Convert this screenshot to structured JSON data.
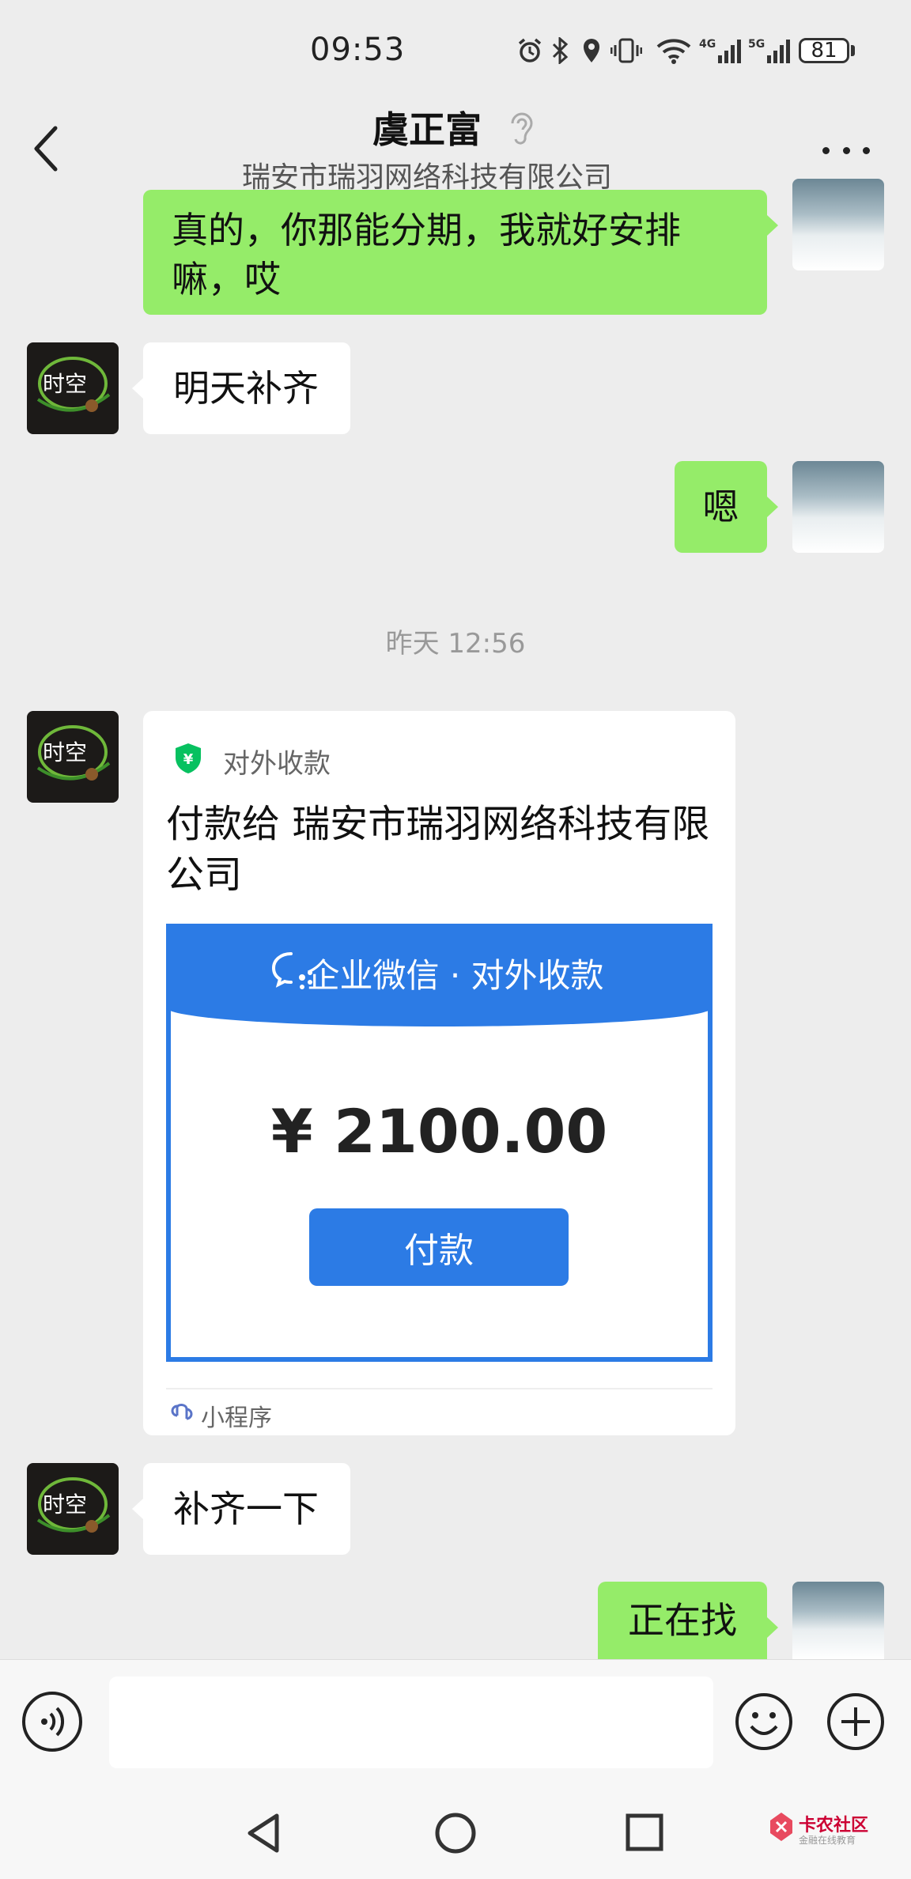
{
  "status_bar": {
    "time": "09:53",
    "battery": "81",
    "network_1": "4G",
    "network_2": "5G",
    "icons": [
      "alarm-icon",
      "bluetooth-icon",
      "location-icon",
      "vibrate-icon",
      "wifi-icon",
      "signal-icon"
    ]
  },
  "header": {
    "title": "虞正富",
    "subtitle": "瑞安市瑞羽网络科技有限公司",
    "back_icon": "chevron-left-icon",
    "more_icon": "more-dots-icon"
  },
  "messages": [
    {
      "side": "out",
      "text": "真的，你那能分期，我就好安排嘛，哎"
    },
    {
      "side": "in",
      "text": "明天补齐"
    },
    {
      "side": "out",
      "text": "嗯"
    },
    {
      "side": "in",
      "text": "补齐一下"
    },
    {
      "side": "out",
      "text": "正在找"
    }
  ],
  "timestamp": "昨天 12:56",
  "pay_card": {
    "label": "对外收款",
    "title": "付款给 瑞安市瑞羽网络科技有限公司",
    "banner": "企业微信 · 对外收款",
    "amount": "¥ 2100.00",
    "button": "付款",
    "footer": "小程序",
    "shield_color": "#07c160",
    "accent_color": "#2c7be5"
  },
  "input_bar": {
    "placeholder": "",
    "voice_icon": "voice-icon",
    "emoji_icon": "emoji-icon",
    "plus_icon": "plus-icon"
  },
  "nav_bar": {
    "icons": [
      "back-triangle-icon",
      "home-circle-icon",
      "recents-square-icon"
    ]
  },
  "watermark": {
    "main": "卡农社区",
    "sub": "金融在线教育"
  },
  "colors": {
    "background": "#ededed",
    "outgoing_bubble": "#95ec69",
    "incoming_bubble": "#ffffff"
  }
}
